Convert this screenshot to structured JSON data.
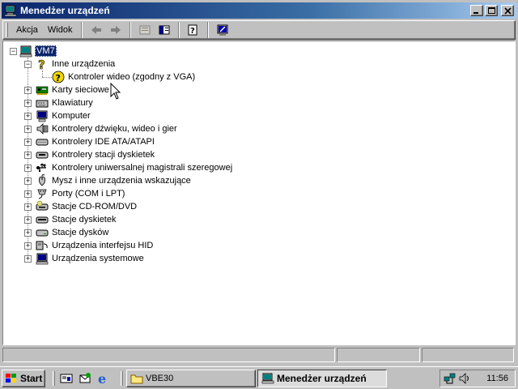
{
  "window": {
    "title": "Menedżer urządzeń"
  },
  "toolbar": {
    "menu_action": "Akcja",
    "menu_view": "Widok",
    "tools": [
      "back-arrow-icon",
      "forward-arrow-icon",
      "properties-icon",
      "view-icon",
      "help-icon",
      "scan-hardware-icon"
    ]
  },
  "tree": {
    "root": "VM7",
    "other_devices": "Inne urządzenia",
    "video_controller": "Kontroler wideo (zgodny z VGA)",
    "categories": [
      {
        "label": "Karty sieciowe",
        "icon": "network-card-icon"
      },
      {
        "label": "Klawiatury",
        "icon": "keyboard-icon"
      },
      {
        "label": "Komputer",
        "icon": "computer-icon"
      },
      {
        "label": "Kontrolery dźwięku, wideo i gier",
        "icon": "sound-icon"
      },
      {
        "label": "Kontrolery IDE ATA/ATAPI",
        "icon": "ide-icon"
      },
      {
        "label": "Kontrolery stacji dyskietek",
        "icon": "floppy-controller-icon"
      },
      {
        "label": "Kontrolery uniwersalnej magistrali szeregowej",
        "icon": "usb-icon"
      },
      {
        "label": "Mysz i inne urządzenia wskazujące",
        "icon": "mouse-icon"
      },
      {
        "label": "Porty (COM i LPT)",
        "icon": "port-icon"
      },
      {
        "label": "Stacje CD-ROM/DVD",
        "icon": "cdrom-icon"
      },
      {
        "label": "Stacje dyskietek",
        "icon": "floppy-drive-icon"
      },
      {
        "label": "Stacje dysków",
        "icon": "disk-drive-icon"
      },
      {
        "label": "Urządzenia interfejsu HID",
        "icon": "hid-icon"
      },
      {
        "label": "Urządzenia systemowe",
        "icon": "system-device-icon"
      }
    ]
  },
  "taskbar": {
    "start": "Start",
    "tasks": [
      "VBE30",
      "Menedżer urządzeń"
    ],
    "clock": "11:56"
  },
  "colors": {
    "titlebar": "#0a246a",
    "face": "#c0c0c0",
    "selection": "#0a246a"
  }
}
